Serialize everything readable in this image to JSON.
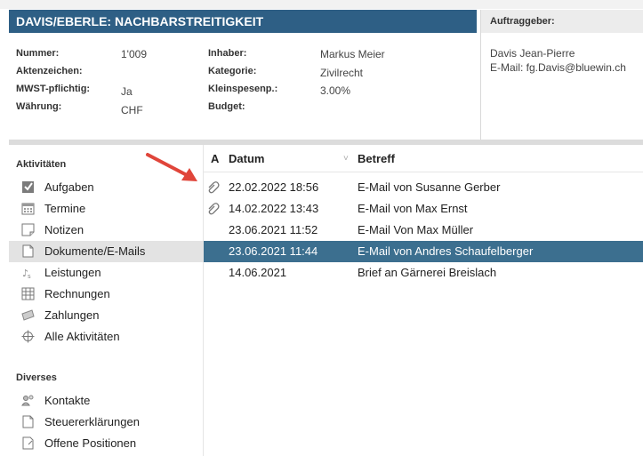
{
  "header": {
    "title": "DAVIS/EBERLE: NACHBARSTREITIGKEIT",
    "fields_left": [
      {
        "label": "Nummer:",
        "value": "1'009"
      },
      {
        "label": "Aktenzeichen:",
        "value": ""
      },
      {
        "label": "MWST-pflichtig:",
        "value": "Ja"
      },
      {
        "label": "Währung:",
        "value": "CHF"
      }
    ],
    "fields_mid": [
      {
        "label": "Inhaber:",
        "value": "Markus Meier"
      },
      {
        "label": "Kategorie:",
        "value": "Zivilrecht"
      },
      {
        "label": "Kleinspesenp.:",
        "value": "3.00%"
      },
      {
        "label": "Budget:",
        "value": ""
      }
    ],
    "client": {
      "label": "Auftraggeber:",
      "name": "Davis Jean-Pierre",
      "email": "E-Mail: fg.Davis@bluewin.ch"
    }
  },
  "sidebar": {
    "activities_title": "Aktivitäten",
    "activities": [
      {
        "label": "Aufgaben",
        "icon": "task-icon",
        "selected": false
      },
      {
        "label": "Termine",
        "icon": "calendar-icon",
        "selected": false
      },
      {
        "label": "Notizen",
        "icon": "note-icon",
        "selected": false
      },
      {
        "label": "Dokumente/E-Mails",
        "icon": "document-icon",
        "selected": true
      },
      {
        "label": "Leistungen",
        "icon": "services-icon",
        "selected": false
      },
      {
        "label": "Rechnungen",
        "icon": "invoice-icon",
        "selected": false
      },
      {
        "label": "Zahlungen",
        "icon": "payment-icon",
        "selected": false
      },
      {
        "label": "Alle Aktivitäten",
        "icon": "all-activities-icon",
        "selected": false
      }
    ],
    "misc_title": "Diverses",
    "misc": [
      {
        "label": "Kontakte",
        "icon": "contacts-icon"
      },
      {
        "label": "Steuererklärungen",
        "icon": "tax-icon"
      },
      {
        "label": "Offene Positionen",
        "icon": "open-items-icon"
      }
    ]
  },
  "list": {
    "columns": {
      "attachment": "A",
      "date": "Datum",
      "subject": "Betreff"
    },
    "rows": [
      {
        "attachment": true,
        "date": "22.02.2022 18:56",
        "subject": "E-Mail von Susanne Gerber",
        "selected": false
      },
      {
        "attachment": true,
        "date": "14.02.2022 13:43",
        "subject": "E-Mail von Max Ernst",
        "selected": false
      },
      {
        "attachment": false,
        "date": "23.06.2021 11:52",
        "subject": "E-Mail Von Max Müller",
        "selected": false
      },
      {
        "attachment": false,
        "date": "23.06.2021 11:44",
        "subject": "E-Mail von Andres Schaufelberger",
        "selected": true
      },
      {
        "attachment": false,
        "date": "14.06.2021",
        "subject": "Brief an Gärnerei Breislach",
        "selected": false
      }
    ]
  },
  "colors": {
    "title_bar": "#2e5f85",
    "selection": "#3c6f8f",
    "arrow": "#e0453a"
  }
}
